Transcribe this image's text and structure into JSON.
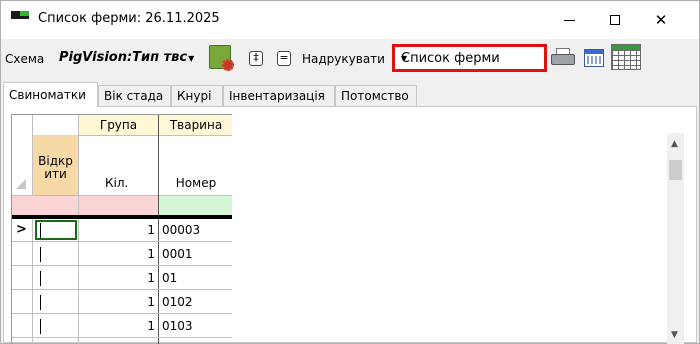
{
  "window": {
    "title": "Список ферми: 26.11.2025",
    "close_glyph": "✕"
  },
  "toolbar": {
    "schema_label": "Схема",
    "schema_value": "PigVision:Тип твс",
    "btn_a_glyph": "‡",
    "btn_b_glyph": "=",
    "print_label": "Надрукувати",
    "print_value": "Список ферми",
    "dropdown_glyph": "▼",
    "icons": [
      "report-gear-icon",
      "printer-icon",
      "calendar-icon",
      "grid-table-icon"
    ]
  },
  "tabs": [
    {
      "label": "Свиноматки",
      "active": true
    },
    {
      "label": "Вік стада",
      "active": false
    },
    {
      "label": "Кнурі",
      "active": false
    },
    {
      "label": "Інвентаризація",
      "active": false
    },
    {
      "label": "Потомство",
      "active": false
    }
  ],
  "grid": {
    "group_headers": [
      "Група",
      "Тварина"
    ],
    "col_open": "Відкр ити",
    "col_qty": "Кіл.",
    "col_number": "Номер",
    "row_indicator": ">",
    "rows": [
      {
        "qty": "1",
        "number": "00003"
      },
      {
        "qty": "1",
        "number": "0001"
      },
      {
        "qty": "1",
        "number": "01"
      },
      {
        "qty": "1",
        "number": "0102"
      },
      {
        "qty": "1",
        "number": "0103"
      }
    ]
  },
  "scrollbar": {
    "up_glyph": "▲",
    "down_glyph": "▼"
  },
  "colors": {
    "highlight_border": "#e01010",
    "group_header_bg": "#fff8d6",
    "open_header_bg": "#f7d9a8",
    "filter_pink": "#fbd5d5",
    "filter_green": "#d5f5d5",
    "focus_border": "#1a6a1a"
  }
}
